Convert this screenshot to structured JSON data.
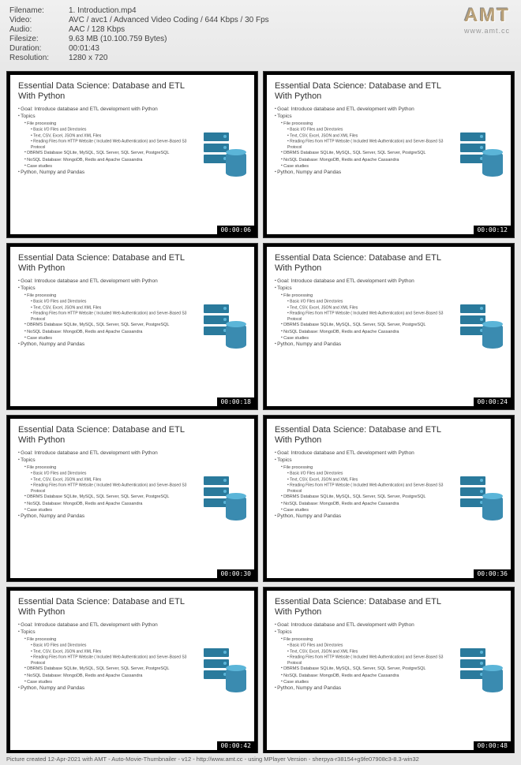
{
  "header": {
    "meta": [
      {
        "label": "Filename:",
        "value": "1. Introduction.mp4"
      },
      {
        "label": "Video:",
        "value": "AVC / avc1 / Advanced Video Coding / 644 Kbps / 30 Fps"
      },
      {
        "label": "Audio:",
        "value": "AAC / 128 Kbps"
      },
      {
        "label": "Filesize:",
        "value": "9.63 MB (10.100.759 Bytes)"
      },
      {
        "label": "Duration:",
        "value": "00:01:43"
      },
      {
        "label": "Resolution:",
        "value": "1280 x 720"
      }
    ],
    "logo": {
      "text": "AMT",
      "sub": "www.amt.cc"
    }
  },
  "slide": {
    "title": "Essential Data Science: Database and ETL With Python",
    "goal": "Goal: Introduce database and ETL development with Python",
    "topics_label": "Topics",
    "fp": "File processing",
    "fp1": "Basic I/O Files and Directories",
    "fp2": "Text, CSV, Excel, JSON and XML Files",
    "fp3": "Reading Files from HTTP Website ( Included Web Authentication) and Server-Based S3 Protocol",
    "db": "DBRMS Database SQLite, MySQL, SQL Server, SQL Server, PostgreSQL",
    "nosql": "NoSQL Database: MongoDB, Redis and Apache Cassandra",
    "cs": "Case studies",
    "libs": "Python, Numpy and Pandas"
  },
  "timestamps": [
    "00:00:06",
    "00:00:12",
    "00:00:18",
    "00:00:24",
    "00:00:30",
    "00:00:36",
    "00:00:42",
    "00:00:48"
  ],
  "footer": "Picture created 12-Apr-2021 with AMT - Auto-Movie-Thumbnailer - v12 - http://www.amt.cc - using MPlayer Version - sherpya-r38154+g9fe07908c3-8.3-win32"
}
